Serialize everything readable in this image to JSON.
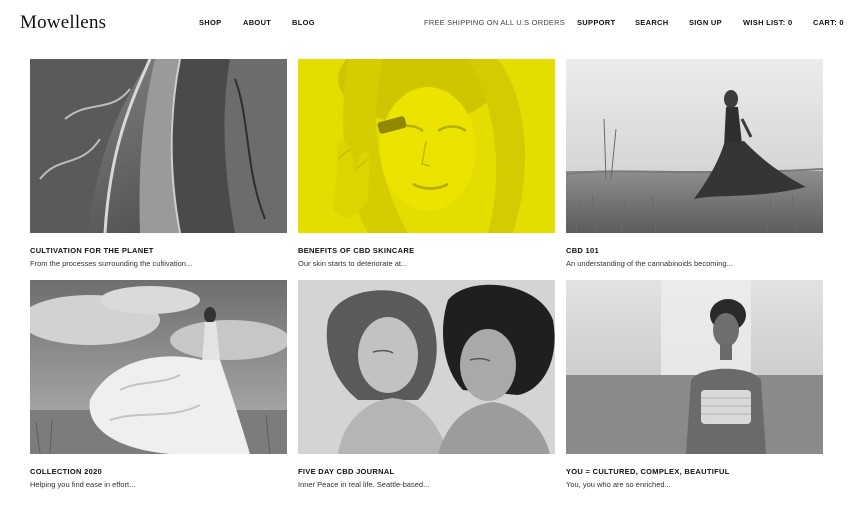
{
  "header": {
    "logo": "Mowellens",
    "nav_left": [
      {
        "label": "SHOP"
      },
      {
        "label": "ABOUT"
      },
      {
        "label": "BLOG"
      }
    ],
    "promo": "FREE SHIPPING ON ALL U.S ORDERS",
    "nav_right": [
      {
        "label": "SUPPORT"
      },
      {
        "label": "SEARCH"
      },
      {
        "label": "SIGN UP"
      },
      {
        "label": "WISH LIST: 0"
      },
      {
        "label": "CART: 0"
      }
    ]
  },
  "posts": [
    {
      "title": "CULTIVATION FOR THE PLANET",
      "excerpt": "From the processes surrounding the cultivation..."
    },
    {
      "title": "BENEFITS OF CBD SKINCARE",
      "excerpt": "Our skin starts to deteriorate at..."
    },
    {
      "title": "CBD 101",
      "excerpt": "An understanding of the cannabinoids becoming..."
    },
    {
      "title": "COLLECTION 2020",
      "excerpt": "Helping you find ease in effort..."
    },
    {
      "title": "FIVE DAY CBD JOURNAL",
      "excerpt": "Inner Peace in real life. Seattle-based..."
    },
    {
      "title": "YOU = CULTURED, COMPLEX, BEAUTIFUL",
      "excerpt": "You, you who are so enriched..."
    }
  ],
  "colors": {
    "accent_yellow": "#e6dd00",
    "text": "#111111"
  }
}
